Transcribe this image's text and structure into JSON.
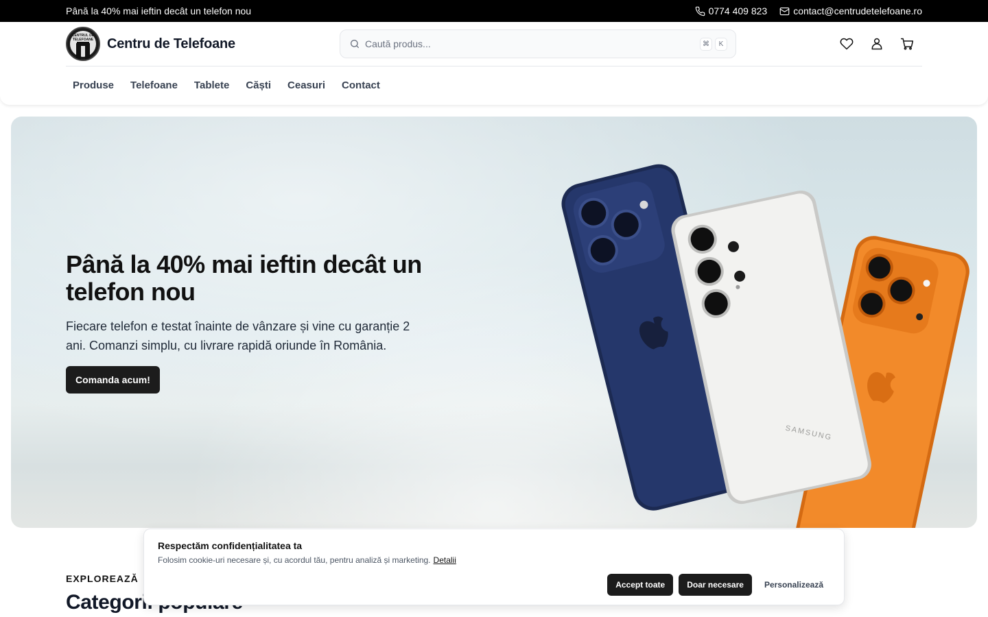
{
  "topbar": {
    "promo": "Până la 40% mai ieftin decât un telefon nou",
    "phone": "0774 409 823",
    "email": "contact@centrudetelefoane.ro"
  },
  "header": {
    "logo_badge_text": "CENTRUL DE TELEFOANE",
    "brand": "Centru de Telefoane",
    "search_placeholder": "Caută produs...",
    "kbd_cmd": "⌘",
    "kbd_k": "K",
    "icons": [
      "heart-icon",
      "user-icon",
      "cart-icon"
    ]
  },
  "nav": {
    "items": [
      "Produse",
      "Telefoane",
      "Tablete",
      "Căști",
      "Ceasuri",
      "Contact"
    ]
  },
  "hero": {
    "title": "Până la 40% mai ieftin decât un telefon nou",
    "subtitle": "Fiecare telefon e testat înainte de vânzare și vine cu garanție 2 ani. Comanzi simplu, cu livrare rapidă oriunde în România.",
    "cta": "Comanda acum!",
    "phone_brand_text": "SAMSUNG"
  },
  "section": {
    "eyebrow": "EXPLOREAZĂ",
    "title": "Categorii populare"
  },
  "cookie": {
    "title": "Respectăm confidențialitatea ta",
    "text": "Folosim cookie-uri necesare și, cu acordul tău, pentru analiză și marketing.",
    "link": "Detalii",
    "accept_all": "Accept toate",
    "necessary_only": "Doar necesare",
    "customize": "Personalizează"
  },
  "colors": {
    "topbar_bg": "#000000",
    "button_dark": "#1c1c1c",
    "phone_blue": "#1f2f5c",
    "phone_white": "#f1f1ef",
    "phone_orange": "#f08423"
  }
}
